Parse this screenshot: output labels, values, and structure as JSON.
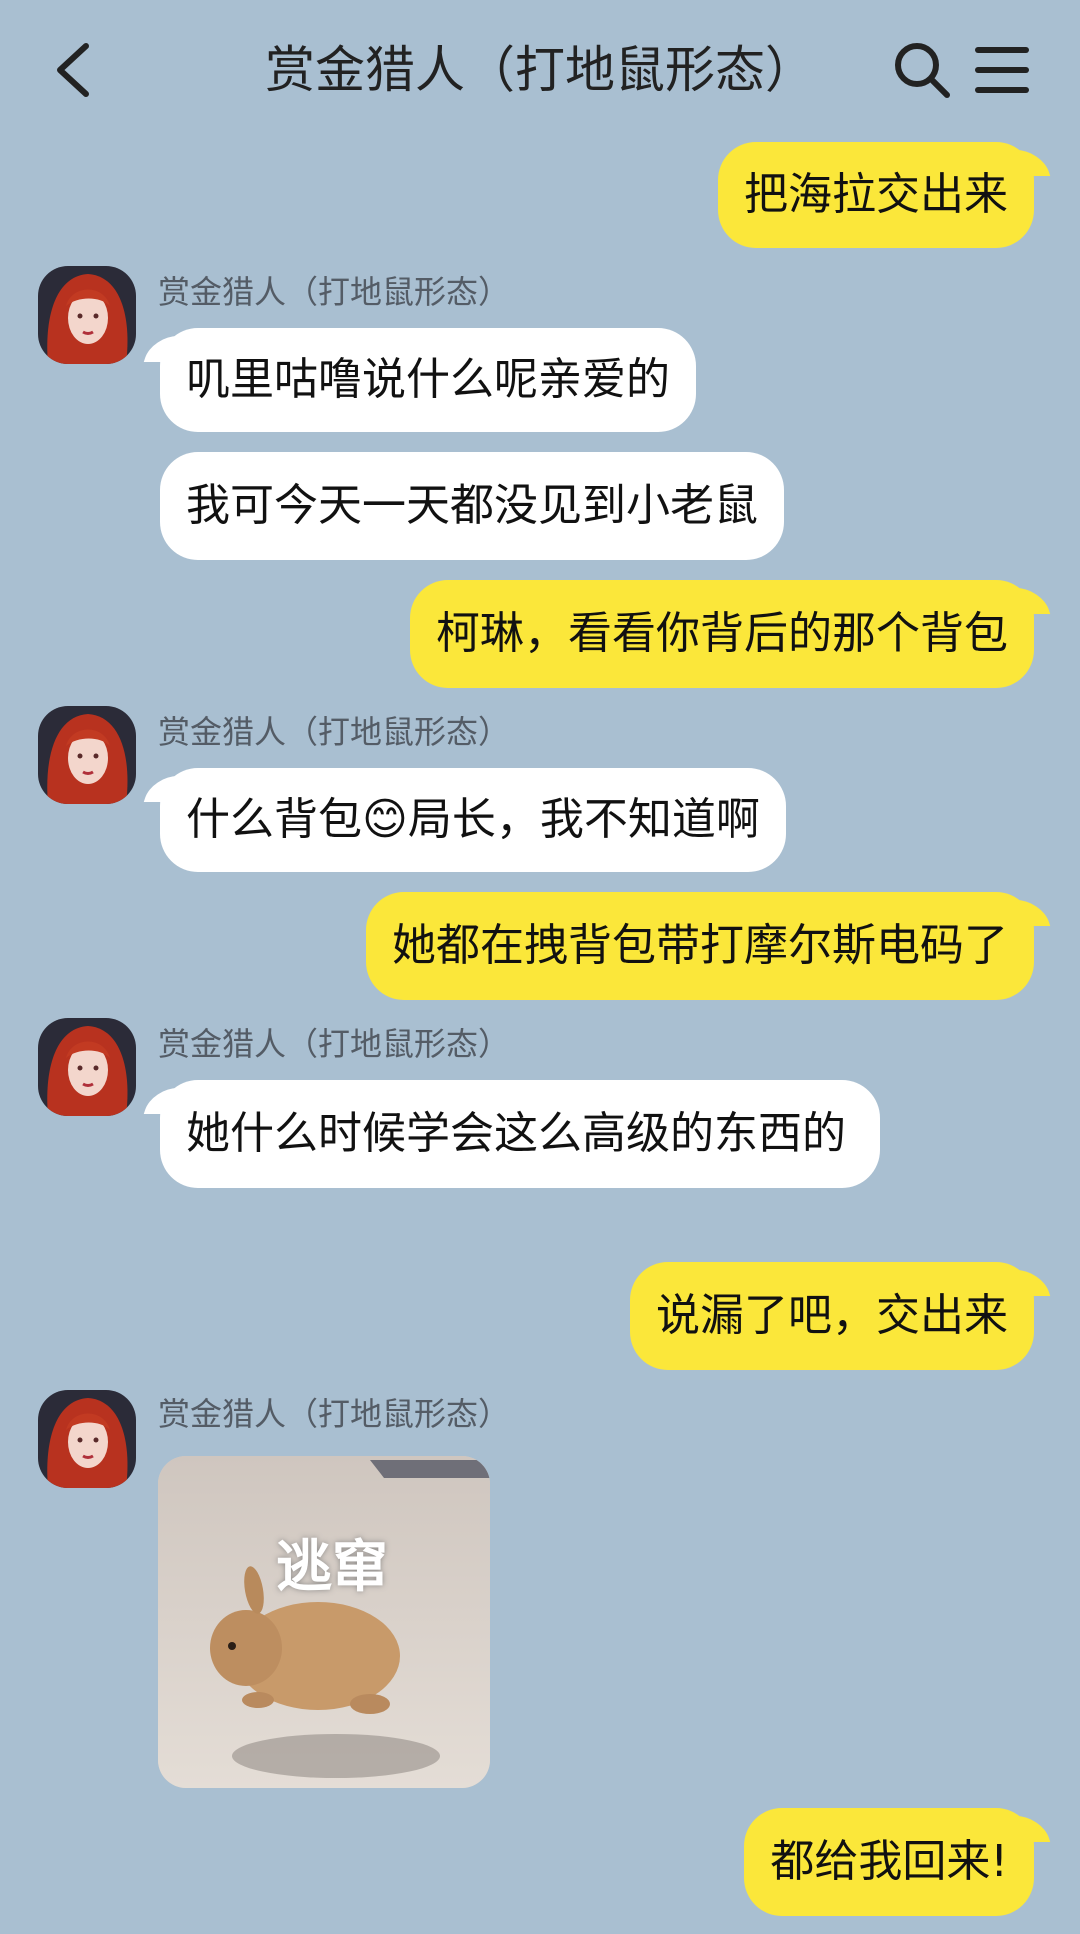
{
  "header": {
    "title": "赏金猎人（打地鼠形态）"
  },
  "contact": {
    "name": "赏金猎人（打地鼠形态）"
  },
  "messages": [
    {
      "from": "me",
      "text": "把海拉交出来"
    },
    {
      "from": "them",
      "text": "叽里咕噜说什么呢亲爱的"
    },
    {
      "from": "them",
      "text": "我可今天一天都没见到小老鼠"
    },
    {
      "from": "me",
      "text": "柯琳，看看你背后的那个背包"
    },
    {
      "from": "them",
      "text_before": "什么背包",
      "emoji": "😊",
      "text_after": "局长，我不知道啊"
    },
    {
      "from": "me",
      "text": "她都在拽背包带打摩尔斯电码了"
    },
    {
      "from": "them",
      "text": "她什么时候学会这么高级的东西的"
    },
    {
      "from": "me",
      "text": "说漏了吧，交出来"
    },
    {
      "from": "them",
      "type": "sticker",
      "sticker_text": "逃窜"
    },
    {
      "from": "me",
      "text": "都给我回来!"
    }
  ],
  "colors": {
    "background": "#a9bfd1",
    "outgoing_bubble": "#fbe73a",
    "incoming_bubble": "#ffffff"
  },
  "icons": [
    "back-arrow-icon",
    "search-icon",
    "menu-icon"
  ]
}
